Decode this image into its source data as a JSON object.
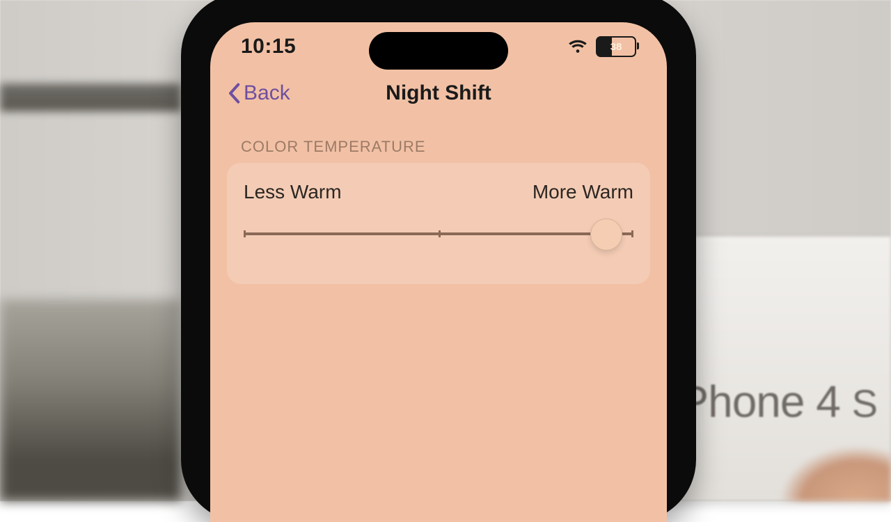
{
  "status": {
    "time": "10:15",
    "battery_percent": "38"
  },
  "nav": {
    "back_label": "Back",
    "title": "Night Shift"
  },
  "section": {
    "header": "COLOR TEMPERATURE",
    "slider": {
      "min_label": "Less Warm",
      "max_label": "More Warm",
      "position_percent": 93
    }
  },
  "background": {
    "box_label_prefix": "Phone 4 ",
    "box_label_suffix": "S"
  }
}
